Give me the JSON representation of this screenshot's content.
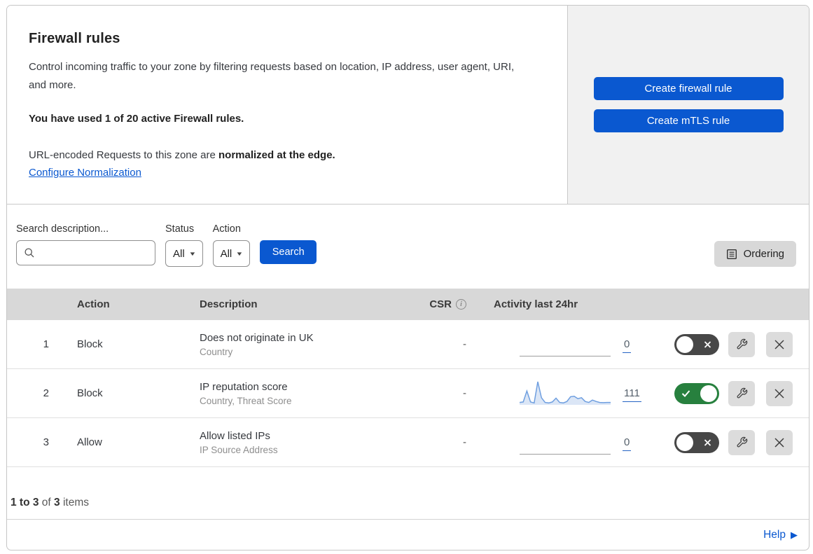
{
  "header": {
    "title": "Firewall rules",
    "description": "Control incoming traffic to your zone by filtering requests based on location, IP address, user agent, URI, and more.",
    "usage_bold": "You have used 1 of 20 active Firewall rules.",
    "normalization_prefix": "URL-encoded Requests to this zone are ",
    "normalization_bold": "normalized at the edge.",
    "normalization_link": "Configure Normalization",
    "buttons": {
      "create_firewall": "Create firewall rule",
      "create_mtls": "Create mTLS rule"
    }
  },
  "filters": {
    "search_label": "Search description...",
    "search_value": "",
    "search_placeholder": "",
    "status_label": "Status",
    "status_value": "All",
    "action_label": "Action",
    "action_value": "All",
    "search_button": "Search",
    "ordering_button": "Ordering"
  },
  "icons": {
    "caret_down": "▼",
    "info": "i",
    "help_arrow": "▶"
  },
  "table": {
    "columns": {
      "action": "Action",
      "description": "Description",
      "csr": "CSR",
      "activity": "Activity last 24hr"
    },
    "rows": [
      {
        "priority": "1",
        "action": "Block",
        "description": "Does not originate in UK",
        "criteria": "Country",
        "csr": "-",
        "activity_count": "0",
        "enabled": false,
        "sparkline": []
      },
      {
        "priority": "2",
        "action": "Block",
        "description": "IP reputation score",
        "criteria": "Country, Threat Score",
        "csr": "-",
        "activity_count": "111",
        "enabled": true,
        "sparkline": [
          10,
          12,
          58,
          12,
          8,
          97,
          30,
          10,
          8,
          12,
          28,
          10,
          8,
          14,
          34,
          36,
          26,
          30,
          14,
          10,
          20,
          14,
          10,
          9,
          10,
          10
        ]
      },
      {
        "priority": "3",
        "action": "Allow",
        "description": "Allow listed IPs",
        "criteria": "IP Source Address",
        "csr": "-",
        "activity_count": "0",
        "enabled": false,
        "sparkline": []
      }
    ]
  },
  "footer": {
    "range_bold": "1 to 3",
    "of_text": "of",
    "total_bold": "3",
    "items_text": "items",
    "help_link": "Help"
  },
  "colors": {
    "accent_blue": "#0a58d0",
    "toggle_on_green": "#27803e",
    "toggle_off_gray": "#474747",
    "header_band_gray": "#d8d8d8",
    "sparkline_line": "#6f9fe0",
    "sparkline_fill": "#dbe6f6"
  }
}
